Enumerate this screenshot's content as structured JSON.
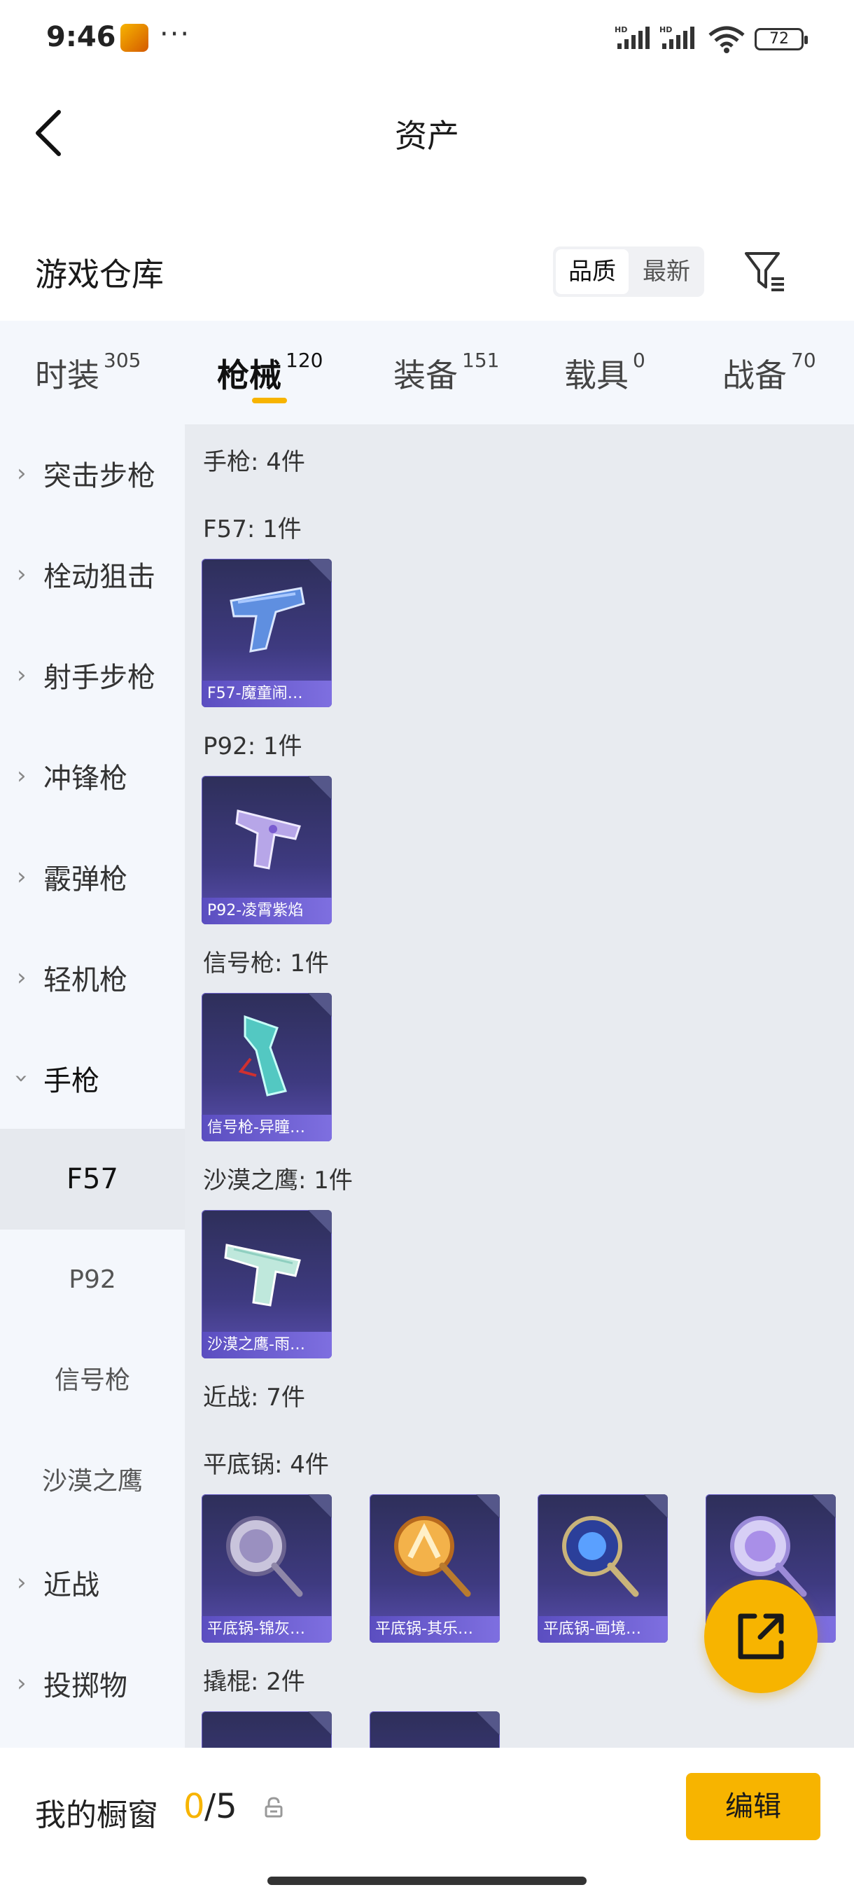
{
  "status_bar": {
    "time": "9:46",
    "more": "···",
    "battery": "72",
    "network_1": "HD",
    "network_2": "HD"
  },
  "header": {
    "title": "资产"
  },
  "warehouse": {
    "title": "游戏仓库",
    "sort_quality": "品质",
    "sort_newest": "最新"
  },
  "tabs": [
    {
      "label": "时装",
      "count": "305"
    },
    {
      "label": "枪械",
      "count": "120"
    },
    {
      "label": "装备",
      "count": "151"
    },
    {
      "label": "载具",
      "count": "0"
    },
    {
      "label": "战备",
      "count": "70"
    }
  ],
  "sidebar": {
    "categories": [
      "突击步枪",
      "栓动狙击",
      "射手步枪",
      "冲锋枪",
      "霰弹枪",
      "轻机枪",
      "手枪"
    ],
    "sub_items": [
      "F57",
      "P92",
      "信号枪",
      "沙漠之鹰"
    ],
    "more_categories": [
      "近战",
      "投掷物"
    ]
  },
  "content": {
    "pistol_header": "手枪: 4件",
    "groups": [
      {
        "label": "F57: 1件",
        "item": "F57-魔童闹…"
      },
      {
        "label": "P92: 1件",
        "item": "P92-凌霄紫焰"
      },
      {
        "label": "信号枪: 1件",
        "item": "信号枪-异瞳…"
      },
      {
        "label": "沙漠之鹰: 1件",
        "item": "沙漠之鹰-雨…"
      }
    ],
    "melee_header": "近战: 7件",
    "pan_label": "平底锅: 4件",
    "pans": [
      "平底锅-锦灰…",
      "平底锅-其乐…",
      "平底锅-画境…"
    ],
    "crowbar_label": "撬棍: 2件"
  },
  "bottom": {
    "showcase_label": "我的橱窗",
    "count_current": "0",
    "count_total": "/5",
    "edit_label": "编辑"
  },
  "colors": {
    "accent": "#f7b400",
    "card_bg": "#3e3a80"
  }
}
